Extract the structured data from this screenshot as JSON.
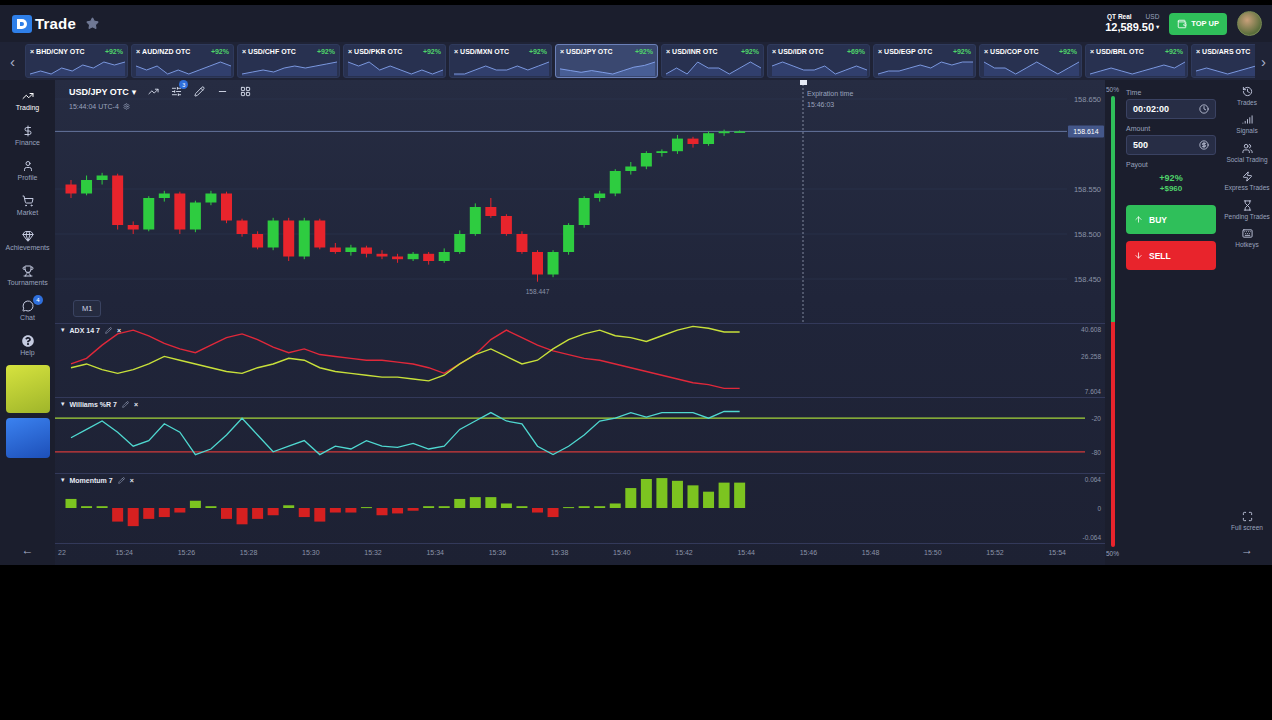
{
  "header": {
    "logo": "Trade",
    "account": "QT Real",
    "currency": "USD",
    "balance": "12,589.50",
    "balance_caret": "▾",
    "top_up": "TOP UP"
  },
  "assets": {
    "prev": "‹",
    "next": "›",
    "close_glyph": "×",
    "items": [
      {
        "label": "BHD/CNY OTC",
        "payout": "+92%",
        "selected": false,
        "spark": [
          5,
          6,
          5,
          7,
          6,
          8,
          7,
          9,
          8,
          9
        ]
      },
      {
        "label": "AUD/NZD OTC",
        "payout": "+92%",
        "selected": false,
        "spark": [
          7,
          6,
          7,
          5,
          6,
          5,
          6,
          7,
          8,
          7
        ]
      },
      {
        "label": "USD/CHF OTC",
        "payout": "+92%",
        "selected": false,
        "spark": [
          4,
          5,
          6,
          5,
          7,
          8,
          7,
          8,
          9,
          10
        ]
      },
      {
        "label": "USD/PKR OTC",
        "payout": "+92%",
        "selected": false,
        "spark": [
          8,
          7,
          8,
          6,
          7,
          6,
          5,
          6,
          5,
          6
        ]
      },
      {
        "label": "USD/MXN OTC",
        "payout": "+92%",
        "selected": false,
        "spark": [
          5,
          5,
          6,
          7,
          6,
          6,
          7,
          6,
          7,
          8
        ]
      },
      {
        "label": "USD/JPY OTC",
        "payout": "+92%",
        "selected": true,
        "spark": [
          6,
          5,
          4,
          5,
          4,
          3,
          5,
          7,
          8,
          10
        ]
      },
      {
        "label": "USD/INR OTC",
        "payout": "+92%",
        "selected": false,
        "spark": [
          6,
          7,
          6,
          8,
          7,
          7,
          6,
          7,
          8,
          7
        ]
      },
      {
        "label": "USD/IDR OTC",
        "payout": "+69%",
        "selected": false,
        "spark": [
          7,
          8,
          7,
          6,
          6,
          7,
          5,
          6,
          7,
          6
        ]
      },
      {
        "label": "USD/EGP OTC",
        "payout": "+92%",
        "selected": false,
        "spark": [
          4,
          5,
          5,
          6,
          7,
          6,
          8,
          7,
          8,
          8
        ]
      },
      {
        "label": "USD/COP OTC",
        "payout": "+92%",
        "selected": false,
        "spark": [
          8,
          7,
          7,
          6,
          7,
          8,
          7,
          6,
          7,
          8
        ]
      },
      {
        "label": "USD/BRL OTC",
        "payout": "+92%",
        "selected": false,
        "spark": [
          5,
          6,
          7,
          6,
          5,
          6,
          7,
          8,
          7,
          9
        ]
      },
      {
        "label": "USD/ARS OTC",
        "selected": false,
        "spark": [
          6,
          7,
          6,
          5,
          6,
          7,
          8,
          7,
          8,
          9
        ]
      }
    ]
  },
  "nav": {
    "items": [
      {
        "label": "Trading",
        "selected": true
      },
      {
        "label": "Finance",
        "selected": false
      },
      {
        "label": "Profile",
        "selected": false
      },
      {
        "label": "Market",
        "selected": false
      },
      {
        "label": "Achievements",
        "selected": false
      },
      {
        "label": "Tournaments",
        "selected": false
      },
      {
        "label": "Chat",
        "selected": false,
        "badge": "4"
      },
      {
        "label": "Help",
        "selected": false
      }
    ],
    "collapse": "←"
  },
  "chart": {
    "symbol": "USD/JPY OTC",
    "symbol_caret": "▾",
    "indicator_badge": "3",
    "clock": "15:44:04 UTC-4",
    "timeframe": "M1",
    "expiration_label": "Expiration time",
    "expiration_time": "15:46:03",
    "current_price": "158.614",
    "low_label": "158.447",
    "price_ticks": [
      "158.650",
      "158.550",
      "158.500",
      "158.450"
    ],
    "candles": [
      [
        158.555,
        158.56,
        158.54,
        158.545
      ],
      [
        158.545,
        158.565,
        158.543,
        158.56
      ],
      [
        158.56,
        158.568,
        158.555,
        158.565
      ],
      [
        158.565,
        158.567,
        158.505,
        158.51
      ],
      [
        158.51,
        158.514,
        158.5,
        158.505
      ],
      [
        158.505,
        158.542,
        158.503,
        158.54
      ],
      [
        158.54,
        158.548,
        158.536,
        158.545
      ],
      [
        158.545,
        158.547,
        158.5,
        158.505
      ],
      [
        158.505,
        158.537,
        158.502,
        158.535
      ],
      [
        158.535,
        158.548,
        158.532,
        158.545
      ],
      [
        158.545,
        158.547,
        158.512,
        158.515
      ],
      [
        158.515,
        158.517,
        158.497,
        158.5
      ],
      [
        158.5,
        158.503,
        158.483,
        158.485
      ],
      [
        158.485,
        158.518,
        158.482,
        158.515
      ],
      [
        158.515,
        158.518,
        158.47,
        158.475
      ],
      [
        158.475,
        158.518,
        158.472,
        158.515
      ],
      [
        158.515,
        158.517,
        158.483,
        158.485
      ],
      [
        158.485,
        158.49,
        158.478,
        158.48
      ],
      [
        158.48,
        158.488,
        158.476,
        158.485
      ],
      [
        158.485,
        158.487,
        158.474,
        158.478
      ],
      [
        158.478,
        158.482,
        158.472,
        158.475
      ],
      [
        158.475,
        158.478,
        158.468,
        158.472
      ],
      [
        158.472,
        158.48,
        158.47,
        158.478
      ],
      [
        158.478,
        158.48,
        158.466,
        158.47
      ],
      [
        158.47,
        158.484,
        158.468,
        158.48
      ],
      [
        158.48,
        158.504,
        158.478,
        158.5
      ],
      [
        158.5,
        158.534,
        158.498,
        158.53
      ],
      [
        158.53,
        158.54,
        158.518,
        158.52
      ],
      [
        158.52,
        158.522,
        158.498,
        158.5
      ],
      [
        158.5,
        158.503,
        158.478,
        158.48
      ],
      [
        158.48,
        158.482,
        158.447,
        158.455
      ],
      [
        158.455,
        158.482,
        158.452,
        158.48
      ],
      [
        158.48,
        158.512,
        158.477,
        158.51
      ],
      [
        158.51,
        158.542,
        158.507,
        158.54
      ],
      [
        158.54,
        158.548,
        158.536,
        158.545
      ],
      [
        158.545,
        158.572,
        158.542,
        158.57
      ],
      [
        158.57,
        158.58,
        158.566,
        158.575
      ],
      [
        158.575,
        158.592,
        158.572,
        158.59
      ],
      [
        158.59,
        158.594,
        158.586,
        158.592
      ],
      [
        158.592,
        158.61,
        158.589,
        158.606
      ],
      [
        158.606,
        158.608,
        158.596,
        158.6
      ],
      [
        158.6,
        158.614,
        158.598,
        158.612
      ],
      [
        158.612,
        158.616,
        158.609,
        158.614
      ],
      [
        158.614,
        158.615,
        158.613,
        158.614
      ]
    ],
    "time_ticks": [
      "22",
      "15:24",
      "15:26",
      "15:28",
      "15:30",
      "15:32",
      "15:34",
      "15:36",
      "15:38",
      "15:40",
      "15:42",
      "15:44",
      "15:46",
      "15:48",
      "15:50",
      "15:52",
      "15:54"
    ]
  },
  "indicator_controls": {
    "caret": "▾",
    "close": "×"
  },
  "adx": {
    "title": "ADX 14 7",
    "ticks": [
      "40.608",
      "26.258",
      "7.604"
    ],
    "plus_di": [
      20,
      22,
      19,
      17,
      19,
      22,
      26,
      24,
      22,
      20,
      18,
      17,
      20,
      22,
      25,
      24,
      20,
      18,
      17,
      16,
      15,
      15,
      14,
      13,
      16,
      22,
      27,
      30,
      26,
      22,
      24,
      30,
      35,
      38,
      40,
      37,
      36,
      34,
      37,
      40,
      42,
      41,
      39,
      39
    ],
    "minus_di": [
      22,
      25,
      32,
      38,
      40,
      37,
      33,
      30,
      28,
      32,
      36,
      38,
      35,
      31,
      28,
      30,
      27,
      26,
      25,
      24,
      24,
      23,
      22,
      20,
      17,
      22,
      27,
      35,
      40,
      36,
      32,
      29,
      27,
      25,
      24,
      22,
      20,
      18,
      16,
      14,
      12,
      11,
      9,
      9
    ]
  },
  "williams": {
    "title": "Williams %R 7",
    "levels": [
      {
        "label": "-20",
        "color": "#a4d63a"
      },
      {
        "label": "-80",
        "color": "#d23a3a"
      }
    ],
    "values": [
      -55,
      -40,
      -25,
      -45,
      -70,
      -60,
      -30,
      -45,
      -85,
      -75,
      -50,
      -20,
      -50,
      -80,
      -70,
      -60,
      -85,
      -70,
      -75,
      -60,
      -70,
      -72,
      -65,
      -75,
      -70,
      -40,
      -25,
      -10,
      -25,
      -30,
      -70,
      -85,
      -70,
      -50,
      -25,
      -20,
      -10,
      -18,
      -10,
      -10,
      -10,
      -20,
      -8,
      -8
    ]
  },
  "momentum": {
    "title": "Momentum 7",
    "ticks": [
      "0.064",
      "0",
      "-0.064"
    ],
    "values": [
      0.02,
      0.004,
      0.004,
      -0.03,
      -0.04,
      -0.024,
      -0.02,
      -0.01,
      0.016,
      0.004,
      -0.024,
      -0.036,
      -0.024,
      -0.016,
      0.006,
      -0.02,
      -0.03,
      -0.01,
      -0.01,
      0.002,
      -0.016,
      -0.012,
      -0.006,
      0.004,
      0.004,
      0.02,
      0.024,
      0.024,
      0.01,
      0.004,
      -0.01,
      -0.02,
      0.002,
      0.004,
      0.004,
      0.01,
      0.044,
      0.064,
      0.066,
      0.06,
      0.05,
      0.036,
      0.056,
      0.056
    ]
  },
  "sentiment": {
    "buy": "50%",
    "sell": "50%",
    "level": 0.5
  },
  "trade": {
    "time_label": "Time",
    "time": "00:02:00",
    "amount_label": "Amount",
    "amount": "500",
    "payout_label": "Payout",
    "payout_pct": "+92%",
    "payout_amount": "+$960",
    "buy": "BUY",
    "sell": "SELL"
  },
  "right_nav": {
    "items": [
      "Trades",
      "Signals",
      "Social Trading",
      "Express Trades",
      "Pending Trades",
      "Hotkeys"
    ],
    "full_screen": "Full screen",
    "expand": "→"
  }
}
